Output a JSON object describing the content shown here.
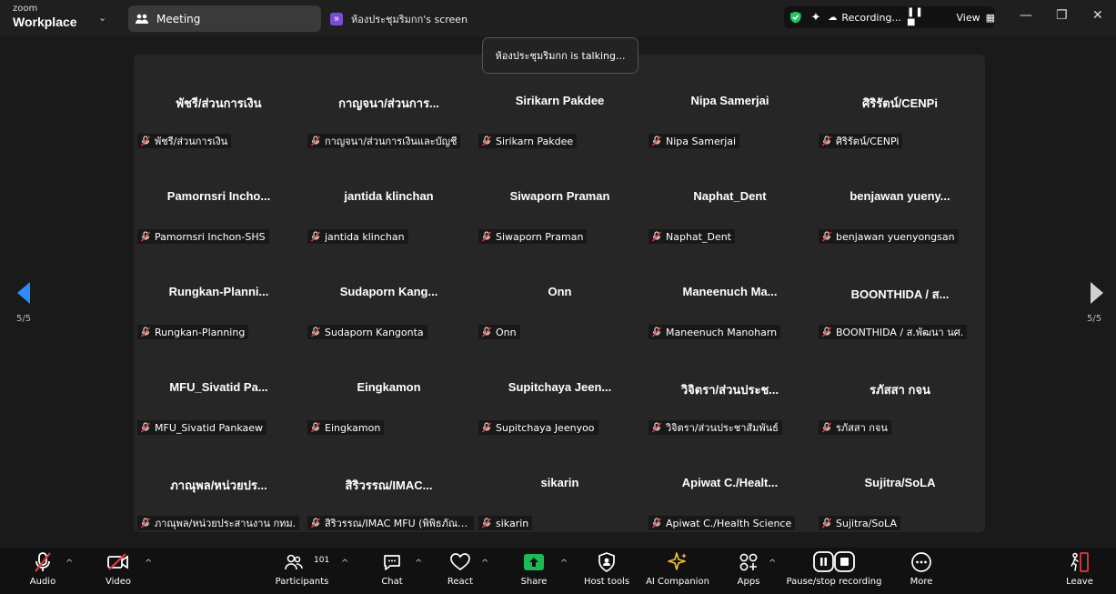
{
  "titlebar": {
    "brand_small": "zoom",
    "brand_large": "Workplace",
    "tab_meeting": "Meeting",
    "tab_screen_badge": "ห",
    "tab_screen": "ห้องประชุมริมกก's screen",
    "recording": "Recording...",
    "view": "View"
  },
  "toast": "ห้องประชุมริมกก is talking...",
  "pagination": {
    "left": "5/5",
    "right": "5/5"
  },
  "participants": [
    {
      "big": "พัชรี/ส่วนการเงิน",
      "label": "พัชรี/ส่วนการเงิน"
    },
    {
      "big": "กาญจนา/ส่วนการ...",
      "label": "กาญจนา/ส่วนการเงินและบัญชี"
    },
    {
      "big": "Sirikarn Pakdee",
      "label": "Sirikarn Pakdee"
    },
    {
      "big": "Nipa Samerjai",
      "label": "Nipa Samerjai"
    },
    {
      "big": "ศิริรัตน์/CENPi",
      "label": "ศิริรัตน์/CENPi"
    },
    {
      "big": "Pamornsri Incho...",
      "label": "Pamornsri Inchon-SHS"
    },
    {
      "big": "jantida klinchan",
      "label": "jantida klinchan"
    },
    {
      "big": "Siwaporn Praman",
      "label": "Siwaporn Praman"
    },
    {
      "big": "Naphat_Dent",
      "label": "Naphat_Dent"
    },
    {
      "big": "benjawan yueny...",
      "label": "benjawan yuenyongsan"
    },
    {
      "big": "Rungkan-Planni...",
      "label": "Rungkan-Planning"
    },
    {
      "big": "Sudaporn Kang...",
      "label": "Sudaporn Kangonta"
    },
    {
      "big": "Onn",
      "label": "Onn"
    },
    {
      "big": "Maneenuch Ma...",
      "label": "Maneenuch Manoharn"
    },
    {
      "big": "BOONTHIDA / ส...",
      "label": "BOONTHIDA / ส.พัฒนา นศ."
    },
    {
      "big": "MFU_Sivatid Pa...",
      "label": "MFU_Sivatid Pankaew"
    },
    {
      "big": "Eingkamon",
      "label": "Eingkamon"
    },
    {
      "big": "Supitchaya Jeen...",
      "label": "Supitchaya Jeenyoo"
    },
    {
      "big": "วิจิตรา/ส่วนประช...",
      "label": "วิจิตรา/ส่วนประชาสัมพันธ์"
    },
    {
      "big": "รภัสสา กจน",
      "label": "รภัสสา กจน"
    },
    {
      "big": "ภาณุพล/หน่วยปร...",
      "label": "ภาณุพล/หน่วยประสานงาน กทม."
    },
    {
      "big": "สิริวรรณ/IMAC...",
      "label": "สิริวรรณ/IMAC MFU (พิพิธภัณฑ์..."
    },
    {
      "big": "sikarin",
      "label": "sikarin"
    },
    {
      "big": "Apiwat C./Healt...",
      "label": "Apiwat C./Health Science"
    },
    {
      "big": "Sujitra/SoLA",
      "label": "Sujitra/SoLA"
    }
  ],
  "toolbar": {
    "audio": "Audio",
    "video": "Video",
    "participants": "Participants",
    "participants_count": "101",
    "chat": "Chat",
    "react": "React",
    "share": "Share",
    "host_tools": "Host tools",
    "ai_companion": "AI Companion",
    "apps": "Apps",
    "pause_recording": "Pause/stop recording",
    "more": "More",
    "leave": "Leave"
  },
  "colors": {
    "share_green": "#1db954",
    "mute_red": "#e5383b",
    "nav_blue": "#2d8cff",
    "shield_green": "#22c55e",
    "leave_red": "#e5383b"
  }
}
